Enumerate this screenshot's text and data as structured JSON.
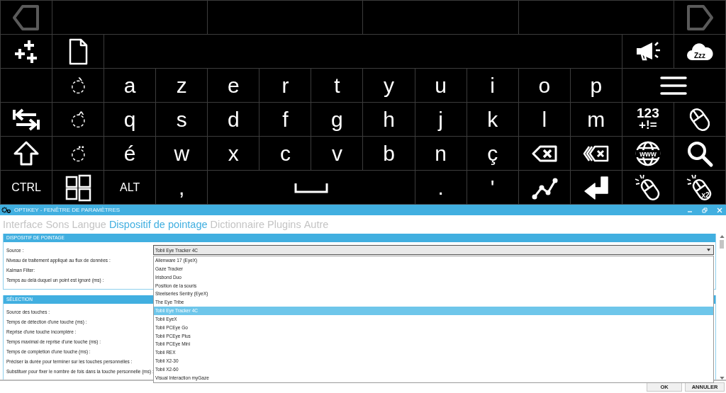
{
  "keyboard": {
    "keys": [
      {
        "kind": "back"
      },
      {
        "kind": "blank"
      },
      {
        "kind": "blank"
      },
      {
        "kind": "blank"
      },
      {
        "kind": "blank"
      },
      {
        "kind": "forward"
      },
      {
        "kind": "add"
      },
      {
        "kind": "document"
      },
      {
        "kind": "display"
      },
      {
        "kind": "megaphone"
      },
      {
        "kind": "sleep",
        "label": "Zzz"
      },
      {
        "kind": "empty"
      },
      {
        "kind": "diacritic",
        "label": "◌̀"
      },
      {
        "kind": "letter",
        "label": "a"
      },
      {
        "kind": "letter",
        "label": "z"
      },
      {
        "kind": "letter",
        "label": "e"
      },
      {
        "kind": "letter",
        "label": "r"
      },
      {
        "kind": "letter",
        "label": "t"
      },
      {
        "kind": "letter",
        "label": "y"
      },
      {
        "kind": "letter",
        "label": "u"
      },
      {
        "kind": "letter",
        "label": "i"
      },
      {
        "kind": "letter",
        "label": "o"
      },
      {
        "kind": "letter",
        "label": "p"
      },
      {
        "kind": "menu"
      },
      {
        "kind": "swap"
      },
      {
        "kind": "diacritic",
        "label": "◌̂"
      },
      {
        "kind": "letter",
        "label": "q"
      },
      {
        "kind": "letter",
        "label": "s"
      },
      {
        "kind": "letter",
        "label": "d"
      },
      {
        "kind": "letter",
        "label": "f"
      },
      {
        "kind": "letter",
        "label": "g"
      },
      {
        "kind": "letter",
        "label": "h"
      },
      {
        "kind": "letter",
        "label": "j"
      },
      {
        "kind": "letter",
        "label": "k"
      },
      {
        "kind": "letter",
        "label": "l"
      },
      {
        "kind": "letter",
        "label": "m"
      },
      {
        "kind": "symbols",
        "label": "123",
        "sublabel": "+!="
      },
      {
        "kind": "mouse"
      },
      {
        "kind": "shift"
      },
      {
        "kind": "diacritic",
        "label": "◌̈"
      },
      {
        "kind": "letter",
        "label": "é"
      },
      {
        "kind": "letter",
        "label": "w"
      },
      {
        "kind": "letter",
        "label": "x"
      },
      {
        "kind": "letter",
        "label": "c"
      },
      {
        "kind": "letter",
        "label": "v"
      },
      {
        "kind": "letter",
        "label": "b"
      },
      {
        "kind": "letter",
        "label": "n"
      },
      {
        "kind": "letter",
        "label": "ç"
      },
      {
        "kind": "backspace"
      },
      {
        "kind": "backword"
      },
      {
        "kind": "web",
        "label": "www"
      },
      {
        "kind": "search"
      },
      {
        "kind": "text",
        "label": "CTRL"
      },
      {
        "kind": "windows"
      },
      {
        "kind": "text",
        "label": "ALT"
      },
      {
        "kind": "letter",
        "label": ","
      },
      {
        "kind": "space"
      },
      {
        "kind": "letter",
        "label": "."
      },
      {
        "kind": "letter",
        "label": "'"
      },
      {
        "kind": "graph"
      },
      {
        "kind": "enter"
      },
      {
        "kind": "click"
      },
      {
        "kind": "doubleclick",
        "label": "x2"
      }
    ]
  },
  "settings": {
    "title": "OPTIKEY - FENÊTRE DE PARAMÈTRES",
    "tabs": [
      {
        "label": "Interface",
        "selected": false
      },
      {
        "label": "Sons",
        "selected": false
      },
      {
        "label": "Langue",
        "selected": false
      },
      {
        "label": "Dispositif de pointage",
        "selected": true
      },
      {
        "label": "Dictionnaire",
        "selected": false
      },
      {
        "label": "Plugins",
        "selected": false
      },
      {
        "label": "Autre",
        "selected": false
      }
    ],
    "sections": [
      {
        "title": "DISPOSITIF DE POINTAGE",
        "fields": [
          "Source :",
          "Niveau de traitement appliqué au flux de données :",
          "Kalman Filter:",
          "Temps au delà duquel un point est ignoré (ms) :"
        ]
      },
      {
        "title": "SÉLECTION",
        "fields": [
          "Source des touches :",
          "Temps de détection d'une touche (ms) :",
          "Reprise d'une touche incomplère :",
          "Temps maximal de reprise d'une touche (ms) :",
          "Temps de completion d'une touche (ms) :",
          "Préciser la durée pour terminer sur les touches personnelles :",
          "Substituer pour fixer le nombre de fois dans la touche personnelle (ms) :"
        ]
      }
    ],
    "dropdown": {
      "value": "Tobii Eye Tracker 4C",
      "options": [
        {
          "label": "Alienware 17 (EyeX)",
          "selected": false
        },
        {
          "label": "Gaze Tracker",
          "selected": false
        },
        {
          "label": "Irisbond Duo",
          "selected": false
        },
        {
          "label": "Position de la souris",
          "selected": false
        },
        {
          "label": "Steelseries Sentry (EyeX)",
          "selected": false
        },
        {
          "label": "The Eye Tribe",
          "selected": false
        },
        {
          "label": "Tobii Eye Tracker 4C",
          "selected": true
        },
        {
          "label": "Tobii EyeX",
          "selected": false
        },
        {
          "label": "Tobii PCEye Go",
          "selected": false
        },
        {
          "label": "Tobii PCEye Plus",
          "selected": false
        },
        {
          "label": "Tobii PCEye Mini",
          "selected": false
        },
        {
          "label": "Tobii REX",
          "selected": false
        },
        {
          "label": "Tobii X2-30",
          "selected": false
        },
        {
          "label": "Tobii X2-60",
          "selected": false
        },
        {
          "label": "Visual Interaction myGaze",
          "selected": false
        }
      ]
    },
    "buttons": [
      "OK",
      "ANNULER"
    ]
  }
}
